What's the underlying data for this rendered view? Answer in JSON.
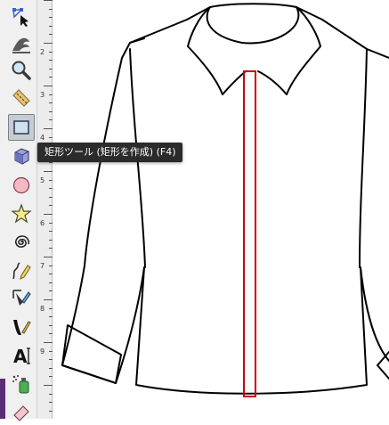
{
  "window": {
    "title": ""
  },
  "toolbox": {
    "tools": [
      {
        "icon": "node-edit-icon",
        "label": ""
      },
      {
        "icon": "tweak-icon",
        "label": ""
      },
      {
        "icon": "zoom-icon",
        "label": ""
      },
      {
        "icon": "measure-icon",
        "label": ""
      },
      {
        "icon": "rectangle-icon",
        "label": "",
        "active": true
      },
      {
        "icon": "3d-box-icon",
        "label": ""
      },
      {
        "icon": "ellipse-icon",
        "label": ""
      },
      {
        "icon": "star-icon",
        "label": ""
      },
      {
        "icon": "spiral-icon",
        "label": ""
      },
      {
        "icon": "pencil-icon",
        "label": ""
      },
      {
        "icon": "pen-icon",
        "label": ""
      },
      {
        "icon": "calligraphy-icon",
        "label": ""
      },
      {
        "icon": "text-icon",
        "label": "A"
      },
      {
        "icon": "spray-icon",
        "label": ""
      },
      {
        "icon": "eraser-icon",
        "label": ""
      }
    ]
  },
  "ruler": {
    "labels": [
      "2",
      "3",
      "4",
      "5",
      "6",
      "7",
      "8",
      "9"
    ]
  },
  "tooltip": {
    "text": "矩形ツール (矩形を作成) (F4)"
  },
  "colors": {
    "placket_stroke": "#cc0000",
    "tooltip_bg": "#2b2b2b",
    "active_tool_bg": "#c8ccd0",
    "accent": "#5a2d76"
  }
}
